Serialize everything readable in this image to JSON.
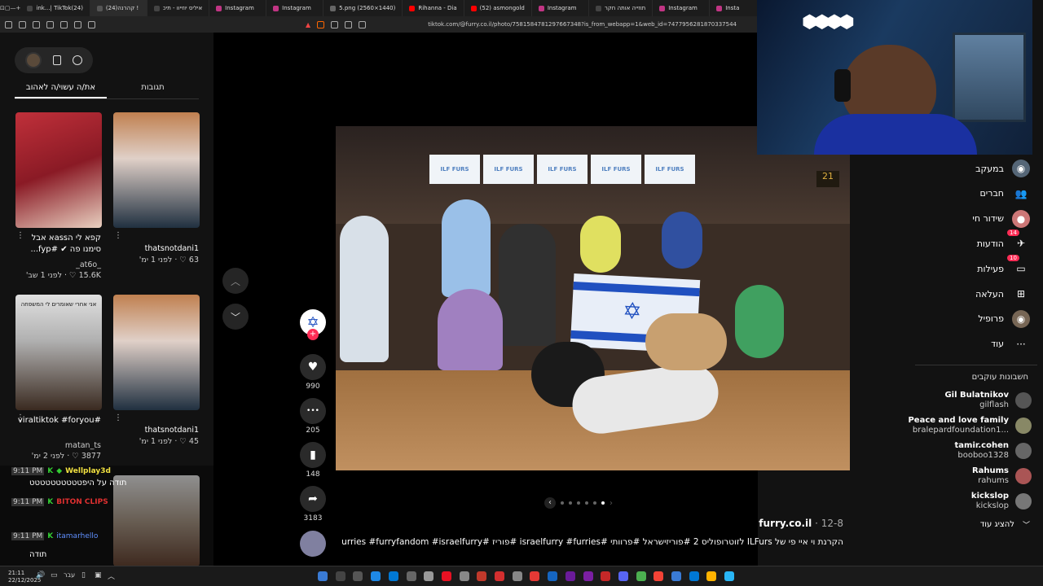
{
  "browser": {
    "tabs": [
      {
        "label": "ink...| TikTok(24)",
        "active": false,
        "color": "#444"
      },
      {
        "label": "(24)קהרנה !",
        "active": true,
        "color": "#555"
      },
      {
        "label": "איליס יוזייוו - תיכ",
        "active": false,
        "color": "#444"
      },
      {
        "label": "Instagram",
        "active": false,
        "color": "#c13584"
      },
      {
        "label": "Instagram",
        "active": false,
        "color": "#c13584"
      },
      {
        "label": "5.png (2560×1440)",
        "active": false,
        "color": "#666"
      },
      {
        "label": "Rihanna - Dia",
        "active": false,
        "color": "#ff0000"
      },
      {
        "label": "(52) asmongold",
        "active": false,
        "color": "#ff0000"
      },
      {
        "label": "Instagram",
        "active": false,
        "color": "#c13584"
      },
      {
        "label": "תוזייה אותה חקר",
        "active": false,
        "color": "#444"
      },
      {
        "label": "Instagram",
        "active": false,
        "color": "#c13584"
      },
      {
        "label": "Insta",
        "active": false,
        "color": "#c13584"
      }
    ],
    "url": "tiktok.com/@furry.co.il/photo/7581584781297667348?is_from_webapp=1&web_id=7477956281870337544"
  },
  "left_panel": {
    "tabs": [
      "את/ה עשוי/ה לאהוב",
      "תגובות"
    ],
    "videos": [
      {
        "caption": "קפא לי הassא אבל סימנו פה ✔ #fyp...",
        "author": "_at6o_",
        "likes": "15.6K",
        "date": "לפני 1 שב'"
      },
      {
        "caption": "",
        "author": "thatsnotdani1",
        "likes": "63",
        "date": "לפני 1 ימ'"
      },
      {
        "caption": "#viraltiktok #foryou",
        "author": "matan_ts",
        "likes": "3877",
        "date": "לפני 2 ימ'"
      },
      {
        "caption": "",
        "author": "thatsnotdani1",
        "likes": "45",
        "date": "לפני 1 ימ'"
      }
    ],
    "thumb3_text": "אני אחרי שאומרים לי המשפחה",
    "chat": [
      {
        "time": "9:11 PM",
        "user": "Wellplay3d",
        "color": "#f0e040",
        "text": ""
      },
      {
        "time": "",
        "user": "",
        "color": "#fff",
        "text": "תודה על היפטטטטטטטטטט"
      },
      {
        "time": "9:11 PM",
        "user": "BITON CLIPS",
        "color": "#e03030",
        "text": ""
      },
      {
        "time": "9:11 PM",
        "user": "itamarhello",
        "color": "#6090ff",
        "text": ""
      }
    ],
    "chat_label": "תודה"
  },
  "post": {
    "actions": [
      {
        "icon": "heart-icon",
        "glyph": "♥",
        "count": "990"
      },
      {
        "icon": "comment-icon",
        "glyph": "•••",
        "count": "205"
      },
      {
        "icon": "bookmark-icon",
        "glyph": "▮",
        "count": "148"
      },
      {
        "icon": "share-icon",
        "glyph": "➦",
        "count": "3183"
      }
    ],
    "author": "furry.co.il",
    "date": "12-8",
    "caption": "הקרנת וי איי פי של ILFurs לזוטרופוליס 2 #פוריזישראל #פרוותי #israelfurry #furries #פוריז #israelfurries #furryfandom #israelfurry",
    "banners": [
      "ILF FURS",
      "ILF FURS",
      "ILF FURS",
      "ILF FURS",
      "ILF FURS"
    ],
    "sign": "21"
  },
  "right_nav": {
    "items": [
      {
        "label": "במעקב",
        "icon": "following-icon"
      },
      {
        "label": "חברים",
        "icon": "friends-icon"
      },
      {
        "label": "שידור חי",
        "icon": "live-icon"
      },
      {
        "label": "הודעות",
        "icon": "messages-icon",
        "badge": "14"
      },
      {
        "label": "פעילות",
        "icon": "activity-icon",
        "badge": "10"
      },
      {
        "label": "העלאה",
        "icon": "upload-icon"
      },
      {
        "label": "פרופיל",
        "icon": "profile-icon"
      },
      {
        "label": "עוד",
        "icon": "more-icon"
      }
    ],
    "following_title": "חשבונות עוקבים",
    "accounts": [
      {
        "name": "Gil Bulatnikov",
        "handle": "gilflash",
        "color": "#555"
      },
      {
        "name": "Peace and love family",
        "handle": "bralepardfoundation1...",
        "color": "#886"
      },
      {
        "name": "tamir.cohen",
        "handle": "booboo1328",
        "color": "#666"
      },
      {
        "name": "Rahums",
        "handle": "rahums",
        "color": "#a55"
      },
      {
        "name": "kickslop",
        "handle": "kickslop",
        "color": "#777"
      }
    ],
    "show_more": "להציג עוד"
  },
  "taskbar": {
    "time": "21:11",
    "date": "22/12/2025",
    "lang": "עבר"
  }
}
